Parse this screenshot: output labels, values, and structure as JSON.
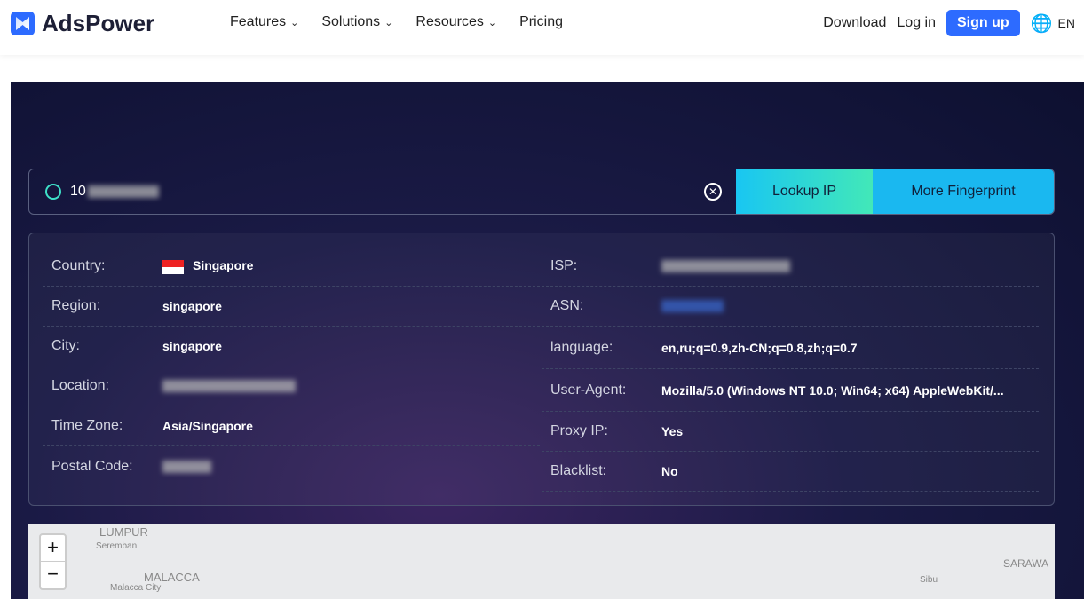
{
  "nav": {
    "brand": "AdsPower",
    "menu": [
      "Features",
      "Solutions",
      "Resources",
      "Pricing"
    ],
    "download": "Download",
    "login": "Log in",
    "signup": "Sign up",
    "lang": "EN"
  },
  "search": {
    "value": "10",
    "lookup": "Lookup IP",
    "more": "More Fingerprint"
  },
  "left": [
    {
      "label": "Country:",
      "value": "Singapore"
    },
    {
      "label": "Region:",
      "value": "singapore"
    },
    {
      "label": "City:",
      "value": "singapore"
    },
    {
      "label": "Location:",
      "value": ""
    },
    {
      "label": "Time Zone:",
      "value": "Asia/Singapore"
    },
    {
      "label": "Postal Code:",
      "value": ""
    }
  ],
  "right": [
    {
      "label": "ISP:",
      "value": ""
    },
    {
      "label": "ASN:",
      "value": ""
    },
    {
      "label": "language:",
      "value": "en,ru;q=0.9,zh-CN;q=0.8,zh;q=0.7"
    },
    {
      "label": "User-Agent:",
      "value": "Mozilla/5.0 (Windows NT 10.0; Win64; x64) AppleWebKit/..."
    },
    {
      "label": "Proxy IP:",
      "value": "Yes"
    },
    {
      "label": "Blacklist:",
      "value": "No"
    }
  ],
  "map": {
    "zoom_in": "+",
    "zoom_out": "−",
    "labels": [
      "LUMPUR",
      "Seremban",
      "MALACCA",
      "Malacca City",
      "SARAWA",
      "Sibu"
    ]
  }
}
